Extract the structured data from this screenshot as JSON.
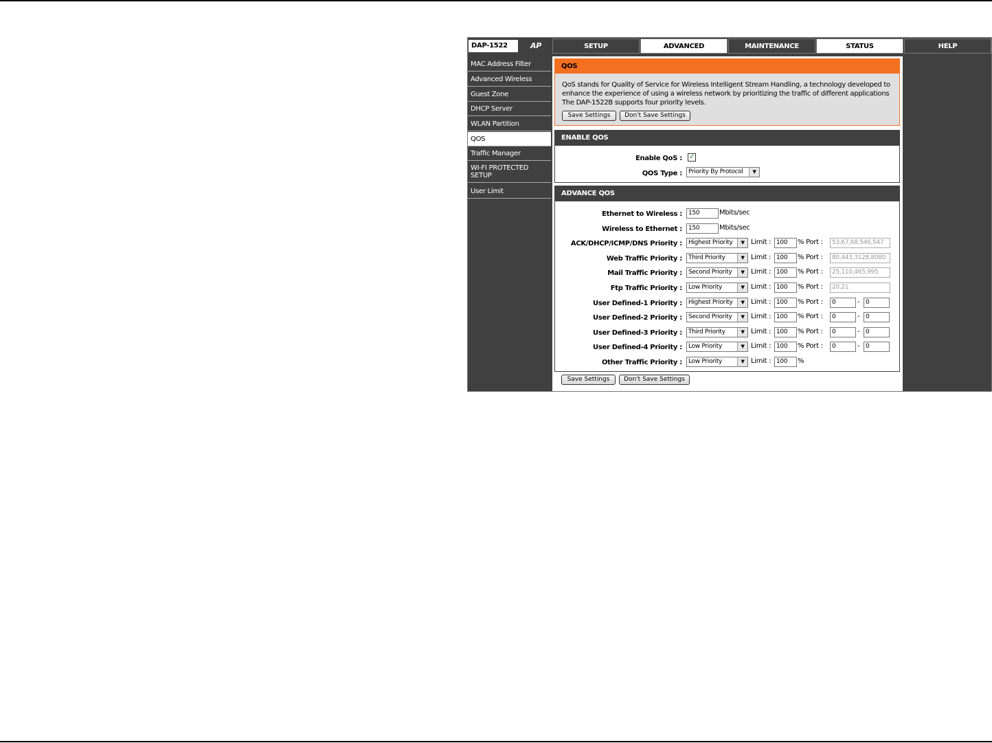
{
  "header": {
    "model": "DAP-1522",
    "mode": "AP",
    "tabs": [
      "SETUP",
      "ADVANCED",
      "MAINTENANCE",
      "STATUS",
      "HELP"
    ]
  },
  "sidebar": {
    "items": [
      "MAC Address Filter",
      "Advanced Wireless",
      "Guest Zone",
      "DHCP Server",
      "WLAN Partition",
      "QOS",
      "Traffic Manager",
      "WI-FI PROTECTED SETUP",
      "User Limit"
    ],
    "active": "QOS"
  },
  "qos": {
    "title": "QOS",
    "description": "QoS stands for Quality of Service for Wireless Intelligent Stream Handling, a technology developed to enhance the experience of using a wireless network by prioritizing the traffic of different applications The DAP-1522B supports four priority levels.",
    "save_label": "Save Settings",
    "dont_save_label": "Don't Save Settings"
  },
  "enable_qos": {
    "title": "ENABLE QOS",
    "enable_label": "Enable QoS :",
    "enabled": true,
    "type_label": "QOS Type :",
    "type_value": "Priority By Protocol"
  },
  "advance_qos": {
    "title": "ADVANCE QOS",
    "eth_to_wl_label": "Ethernet to Wireless :",
    "eth_to_wl_value": "150",
    "wl_to_eth_label": "Wireless to Ethernet :",
    "wl_to_eth_value": "150",
    "unit": "Mbits/sec",
    "limit_label": "Limit :",
    "percent": "%",
    "port_label": "% Port :",
    "dash": "-",
    "rows": [
      {
        "label": "ACK/DHCP/ICMP/DNS Priority :",
        "priority": "Highest Priority",
        "limit": "100",
        "port": "53,67,68,546,547"
      },
      {
        "label": "Web Traffic Priority :",
        "priority": "Third Priority",
        "limit": "100",
        "port": "80,443,3128,8080"
      },
      {
        "label": "Mail Traffic Priority :",
        "priority": "Second Priority",
        "limit": "100",
        "port": "25,110,465,995"
      },
      {
        "label": "Ftp Traffic Priority :",
        "priority": "Low Priority",
        "limit": "100",
        "port": "20,21"
      },
      {
        "label": "User Defined-1 Priority :",
        "priority": "Highest Priority",
        "limit": "100",
        "port_from": "0",
        "port_to": "0"
      },
      {
        "label": "User Defined-2 Priority :",
        "priority": "Second Priority",
        "limit": "100",
        "port_from": "0",
        "port_to": "0"
      },
      {
        "label": "User Defined-3 Priority :",
        "priority": "Third Priority",
        "limit": "100",
        "port_from": "0",
        "port_to": "0"
      },
      {
        "label": "User Defined-4 Priority :",
        "priority": "Low Priority",
        "limit": "100",
        "port_from": "0",
        "port_to": "0"
      },
      {
        "label": "Other Traffic Priority :",
        "priority": "Low Priority",
        "limit": "100"
      }
    ],
    "save_label": "Save Settings",
    "dont_save_label": "Don't Save Settings"
  }
}
